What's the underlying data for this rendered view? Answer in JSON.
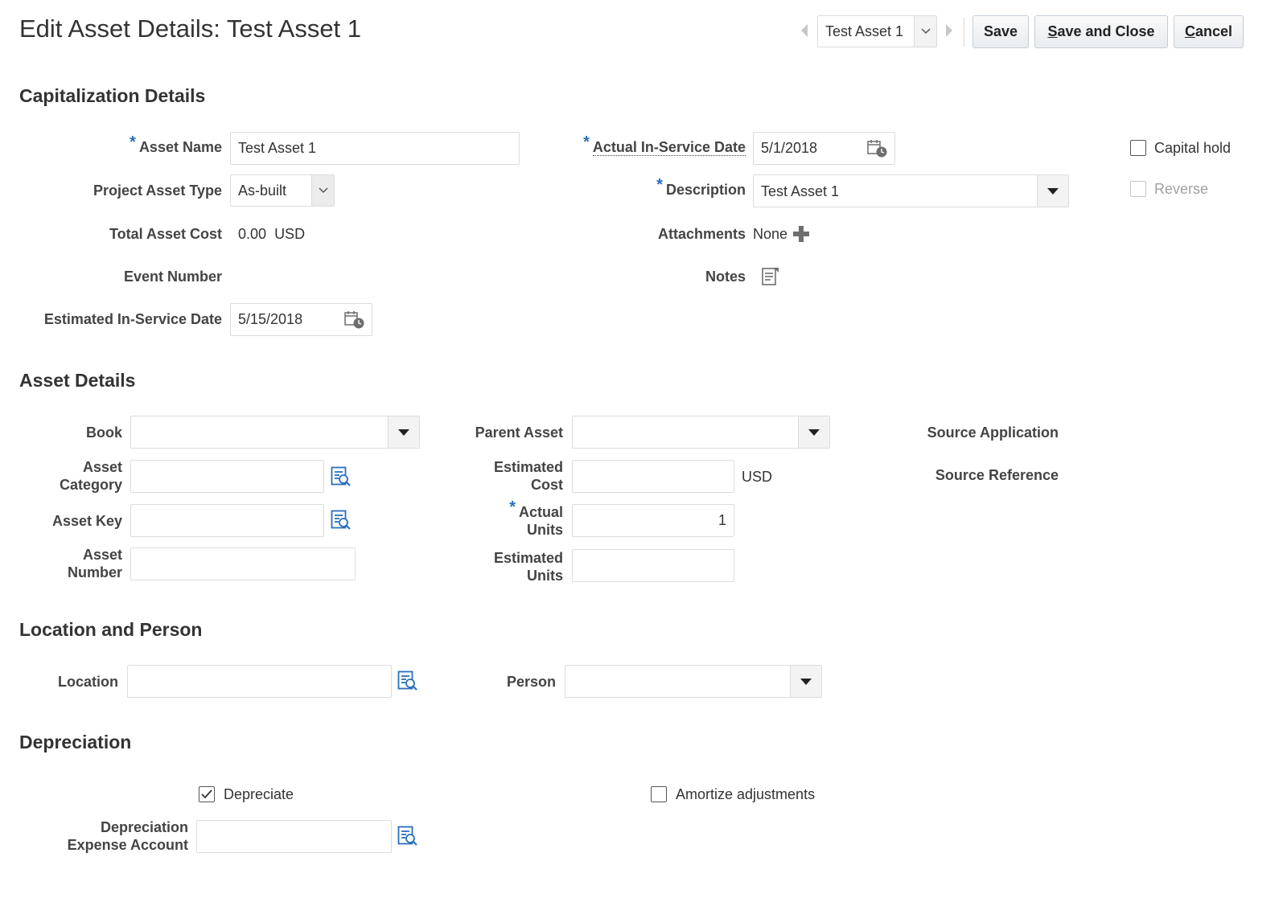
{
  "header": {
    "title": "Edit Asset Details: Test Asset 1",
    "record_selector": "Test Asset 1",
    "save_label": "Save",
    "save_close_label": "Save and Close",
    "save_close_mnemonic": "S",
    "save_close_rest": "ave and Close",
    "cancel_mnemonic": "C",
    "cancel_rest": "ancel"
  },
  "capitalization": {
    "section_title": "Capitalization Details",
    "asset_name_label": "Asset Name",
    "asset_name_value": "Test Asset 1",
    "project_asset_type_label": "Project Asset Type",
    "project_asset_type_value": "As-built",
    "total_asset_cost_label": "Total Asset Cost",
    "total_asset_cost_value": "0.00",
    "total_asset_cost_currency": "USD",
    "event_number_label": "Event Number",
    "estimated_in_service_date_label": "Estimated In-Service Date",
    "estimated_in_service_date_value": "5/15/2018",
    "actual_in_service_date_label": "Actual In-Service Date",
    "actual_in_service_date_value": "5/1/2018",
    "description_label": "Description",
    "description_value": "Test Asset 1",
    "attachments_label": "Attachments",
    "attachments_value": "None",
    "notes_label": "Notes",
    "capital_hold_label": "Capital hold",
    "capital_hold_checked": false,
    "reverse_label": "Reverse",
    "reverse_checked": false,
    "required_marker": "*"
  },
  "asset_details": {
    "section_title": "Asset Details",
    "book_label": "Book",
    "book_value": "",
    "asset_category_label_1": "Asset",
    "asset_category_label_2": "Category",
    "asset_category_value": "",
    "asset_key_label": "Asset Key",
    "asset_key_value": "",
    "asset_number_label_1": "Asset",
    "asset_number_label_2": "Number",
    "asset_number_value": "",
    "parent_asset_label": "Parent Asset",
    "parent_asset_value": "",
    "estimated_cost_label_1": "Estimated",
    "estimated_cost_label_2": "Cost",
    "estimated_cost_value": "",
    "estimated_cost_currency": "USD",
    "actual_units_label_1": "Actual",
    "actual_units_label_2": "Units",
    "actual_units_value": "1",
    "estimated_units_label_1": "Estimated",
    "estimated_units_label_2": "Units",
    "estimated_units_value": "",
    "source_application_label": "Source Application",
    "source_reference_label": "Source Reference"
  },
  "location_person": {
    "section_title": "Location and Person",
    "location_label": "Location",
    "location_value": "",
    "person_label": "Person",
    "person_value": ""
  },
  "depreciation": {
    "section_title": "Depreciation",
    "depreciate_label": "Depreciate",
    "depreciate_checked": true,
    "amortize_label": "Amortize adjustments",
    "amortize_checked": false,
    "expense_account_label_1": "Depreciation",
    "expense_account_label_2": "Expense Account",
    "expense_account_value": ""
  },
  "icons": {
    "calendar": "calendar-icon",
    "search": "search-list-icon",
    "add": "plus-icon",
    "notes": "notes-icon"
  },
  "colors": {
    "required": "#2a6ebb",
    "link_icon": "#2a6ebb",
    "label": "#444444"
  }
}
